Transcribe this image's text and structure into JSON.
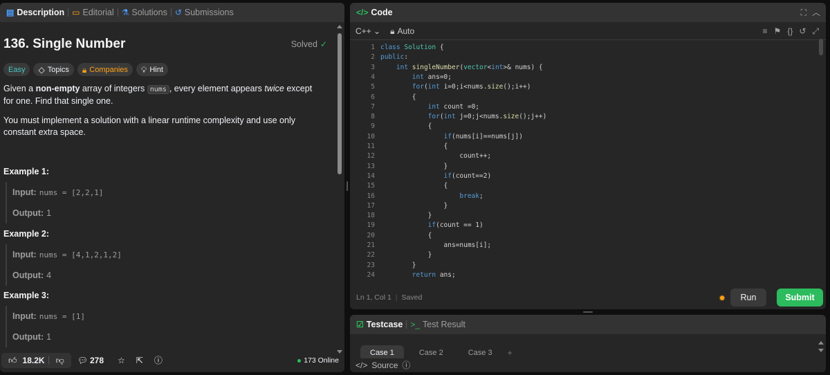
{
  "left_panel": {
    "tabs": [
      {
        "label": "Description",
        "icon": "description-icon",
        "active": true
      },
      {
        "label": "Editorial",
        "icon": "book-icon",
        "active": false
      },
      {
        "label": "Solutions",
        "icon": "flask-icon",
        "active": false
      },
      {
        "label": "Submissions",
        "icon": "history-icon",
        "active": false
      }
    ],
    "title": "136. Single Number",
    "status": "Solved",
    "tags": {
      "difficulty": "Easy",
      "topics": "Topics",
      "companies": "Companies",
      "hint": "Hint"
    },
    "description": {
      "p1_a": "Given a ",
      "p1_bold": "non-empty",
      "p1_b": " array of integers ",
      "p1_code": "nums",
      "p1_c": ", every element appears ",
      "p1_em": "twice",
      "p1_d": " except for one. Find that single one.",
      "p2": "You must implement a solution with a linear runtime complexity and use only constant extra space."
    },
    "examples": [
      {
        "heading": "Example 1:",
        "input_label": "Input:",
        "input_value": "nums = [2,2,1]",
        "output_label": "Output:",
        "output_value": "1"
      },
      {
        "heading": "Example 2:",
        "input_label": "Input:",
        "input_value": "nums = [4,1,2,1,2]",
        "output_label": "Output:",
        "output_value": "4"
      },
      {
        "heading": "Example 3:",
        "input_label": "Input:",
        "input_value": "nums = [1]",
        "output_label": "Output:",
        "output_value": "1"
      }
    ],
    "footer": {
      "likes": "18.2K",
      "comments": "278",
      "online": "173 Online"
    }
  },
  "code_panel": {
    "title": "Code",
    "language": "C++",
    "mode": "Auto",
    "lines": [
      "class Solution {",
      "public:",
      "    int singleNumber(vector<int>& nums) {",
      "        int ans=0;",
      "        for(int i=0;i<nums.size();i++)",
      "        {",
      "            int count =0;",
      "            for(int j=0;j<nums.size();j++)",
      "            {",
      "                if(nums[i]==nums[j])",
      "                {",
      "                    count++;",
      "                }",
      "                if(count==2)",
      "                {",
      "                    break;",
      "                }",
      "            }",
      "            if(count == 1)",
      "            {",
      "                ans=nums[i];",
      "            }",
      "        }",
      "        return ans;"
    ],
    "status_line": "Ln 1, Col 1",
    "saved": "Saved",
    "run_label": "Run",
    "submit_label": "Submit"
  },
  "test_panel": {
    "testcase_label": "Testcase",
    "result_label": "Test Result",
    "cases": [
      "Case 1",
      "Case 2",
      "Case 3"
    ],
    "source_label": "Source"
  },
  "colors": {
    "accent_green": "#2cbb5d",
    "easy": "#46c6c2",
    "companies": "#ffa116"
  }
}
